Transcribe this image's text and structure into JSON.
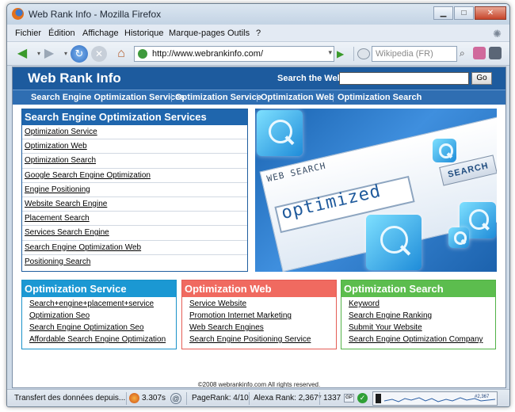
{
  "window": {
    "title": "Web Rank Info - Mozilla Firefox",
    "minimize": "▁",
    "maximize": "□",
    "close": "✕"
  },
  "menu": {
    "items": [
      "Fichier",
      "Édition",
      "Affichage",
      "Historique",
      "Marque-pages",
      "Outils",
      "?"
    ]
  },
  "toolbar": {
    "url": "http://www.webrankinfo.com/",
    "search_placeholder": "Wikipedia (FR)",
    "icons": {
      "back": "back-arrow-icon",
      "forward": "forward-arrow-icon",
      "reload": "reload-icon",
      "stop": "stop-icon",
      "home": "home-icon"
    }
  },
  "site": {
    "title": "Web Rank Info",
    "search_label": "Search the Web:",
    "search_button": "Go",
    "nav": [
      "Search Engine Optimization Services",
      "Optimization Service",
      "Optimization Web",
      "Optimization Search"
    ],
    "seo_panel": {
      "title": "Search Engine Optimization Services",
      "links": [
        "Optimization Service",
        "Optimization Web",
        "Optimization Search",
        "Google Search Engine Optimization",
        "Engine Positioning",
        "Website Search Engine",
        "Placement Search",
        "Services Search Engine",
        "Search Engine Optimization Web",
        "Positioning Search"
      ]
    },
    "hero": {
      "tag": "WEB SEARCH",
      "button": "SEARCH",
      "typed": "optimized"
    },
    "panels": [
      {
        "title": "Optimization Service",
        "color": "#1b98d3",
        "links": [
          "Search+engine+placement+service",
          "Optimization Seo",
          "Search Engine Optimization Seo",
          "Affordable Search Engine Optimization"
        ]
      },
      {
        "title": "Optimization Web",
        "color": "#f06a60",
        "links": [
          "Service Website",
          "Promotion Internet Marketing",
          "Web Search Engines",
          "Search Engine Positioning Service"
        ]
      },
      {
        "title": "Optimization Search",
        "color": "#5cbd4e",
        "links": [
          "Keyword",
          "Search Engine Ranking",
          "Submit Your Website",
          "Search Engine Optimization Company"
        ]
      }
    ],
    "copyright": "©2008 webrankinfo.com All rights reserved."
  },
  "status": {
    "text": "Transfert des données depuis...",
    "timer": "3.307s",
    "pagerank": "PageRank: 4/10",
    "alexa": "Alexa Rank: 2,367*",
    "count": "1337",
    "gp": "GP",
    "graph_value": "#2,367"
  },
  "colors": {
    "site_header": "#1d5b9e",
    "site_nav": "#2f6eb2",
    "panel_blue": "#1b98d3",
    "panel_red": "#f06a60",
    "panel_green": "#5cbd4e"
  }
}
